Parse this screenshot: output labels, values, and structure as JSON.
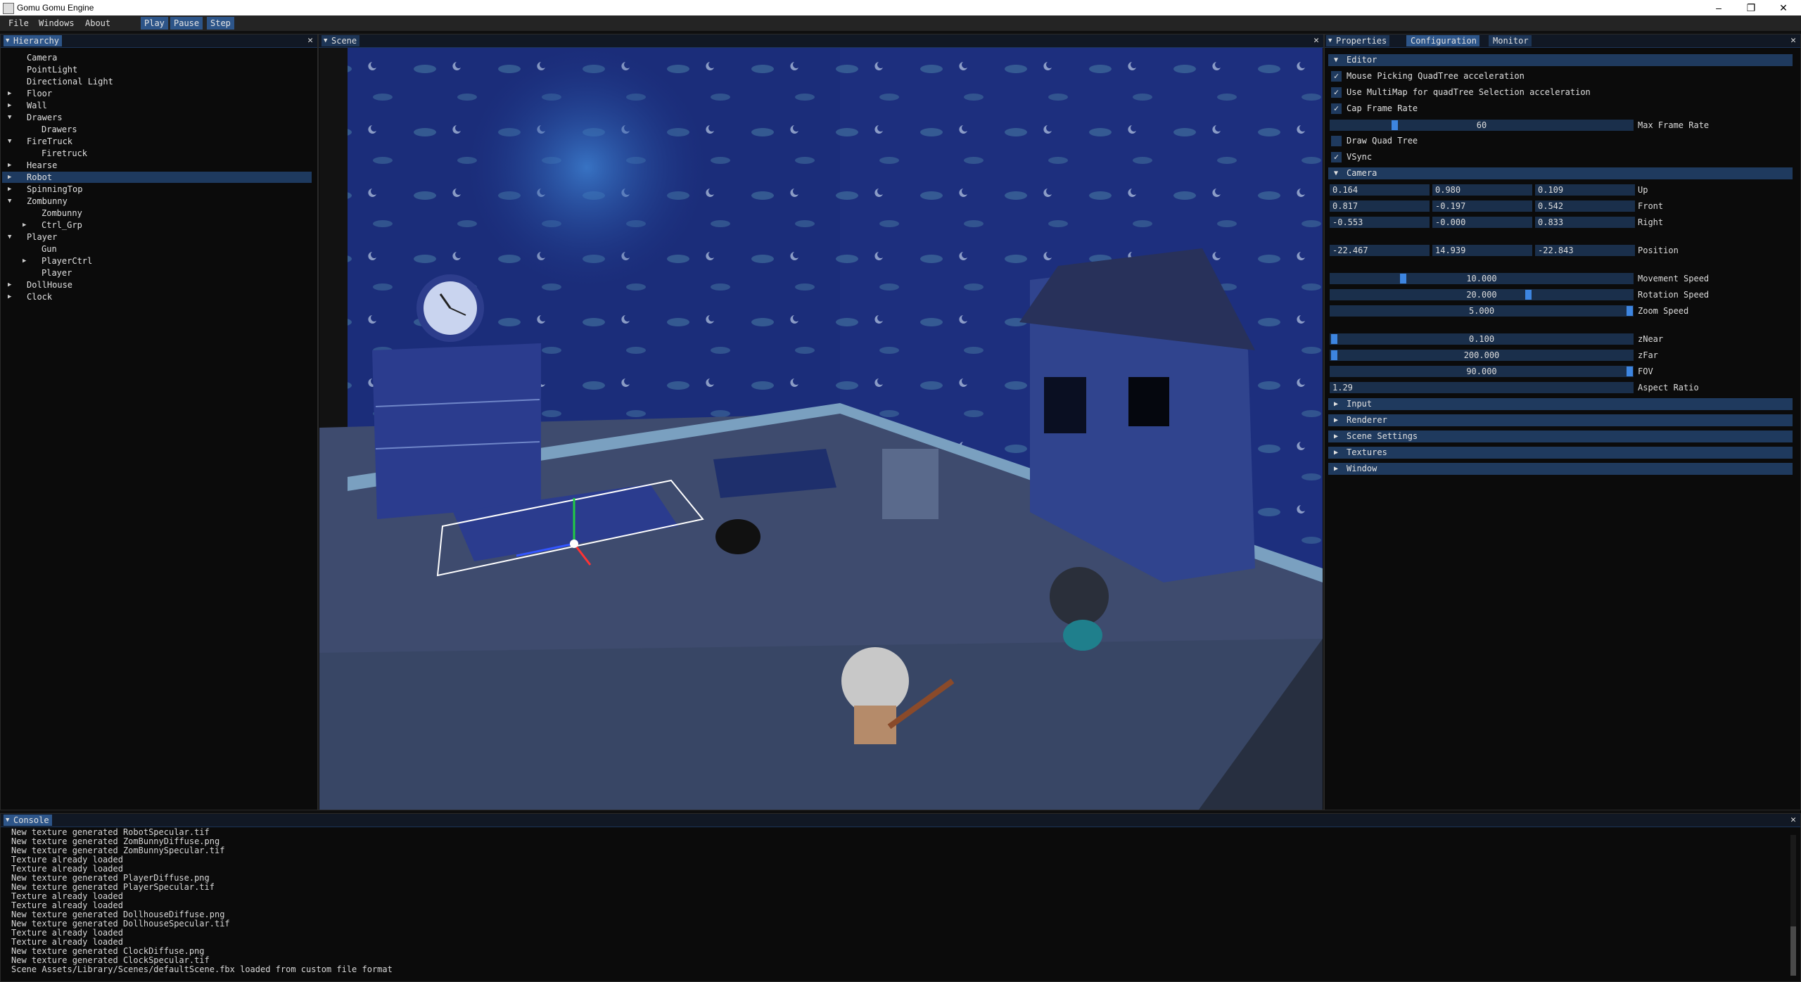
{
  "window": {
    "title": "Gomu Gomu Engine"
  },
  "menubar": {
    "file": "File",
    "windows": "Windows",
    "about": "About",
    "play": "Play",
    "pause": "Pause",
    "step": "Step"
  },
  "hierarchy": {
    "title": "Hierarchy",
    "items": [
      {
        "label": "Camera",
        "depth": 1,
        "arrow": ""
      },
      {
        "label": "PointLight",
        "depth": 1,
        "arrow": ""
      },
      {
        "label": "Directional Light",
        "depth": 1,
        "arrow": ""
      },
      {
        "label": "Floor",
        "depth": 1,
        "arrow": "collapsed"
      },
      {
        "label": "Wall",
        "depth": 1,
        "arrow": "collapsed"
      },
      {
        "label": "Drawers",
        "depth": 1,
        "arrow": "expanded"
      },
      {
        "label": "Drawers",
        "depth": 2,
        "arrow": ""
      },
      {
        "label": "FireTruck",
        "depth": 1,
        "arrow": "expanded"
      },
      {
        "label": "Firetruck",
        "depth": 2,
        "arrow": ""
      },
      {
        "label": "Hearse",
        "depth": 1,
        "arrow": "collapsed"
      },
      {
        "label": "Robot",
        "depth": 1,
        "arrow": "collapsed",
        "selected": true
      },
      {
        "label": "SpinningTop",
        "depth": 1,
        "arrow": "collapsed"
      },
      {
        "label": "Zombunny",
        "depth": 1,
        "arrow": "expanded"
      },
      {
        "label": "Zombunny",
        "depth": 2,
        "arrow": ""
      },
      {
        "label": "Ctrl_Grp",
        "depth": 2,
        "arrow": "collapsed"
      },
      {
        "label": "Player",
        "depth": 1,
        "arrow": "expanded"
      },
      {
        "label": "Gun",
        "depth": 2,
        "arrow": ""
      },
      {
        "label": "PlayerCtrl",
        "depth": 2,
        "arrow": "collapsed"
      },
      {
        "label": "Player",
        "depth": 2,
        "arrow": ""
      },
      {
        "label": "DollHouse",
        "depth": 1,
        "arrow": "collapsed"
      },
      {
        "label": "Clock",
        "depth": 1,
        "arrow": "collapsed"
      }
    ]
  },
  "scene": {
    "title": "Scene"
  },
  "properties": {
    "tabs": [
      "Properties",
      "Configuration",
      "Monitor"
    ],
    "active_tab": 1,
    "editor": {
      "header": "Editor",
      "mouse_picking": "Mouse Picking QuadTree acceleration",
      "use_multimap": "Use MultiMap for quadTree Selection acceleration",
      "cap_frame_rate": "Cap Frame Rate",
      "max_frame_rate_value": "60",
      "max_frame_rate_fraction": 0.23,
      "max_frame_rate_label": "Max Frame Rate",
      "draw_quad_tree": "Draw Quad Tree",
      "vsync": "VSync",
      "checked": {
        "mouse_picking": true,
        "use_multimap": true,
        "cap_frame_rate": true,
        "draw_quad_tree": false,
        "vsync": true
      }
    },
    "camera": {
      "header": "Camera",
      "up": [
        "0.164",
        "0.980",
        "0.109"
      ],
      "up_label": "Up",
      "front": [
        "0.817",
        "-0.197",
        "0.542"
      ],
      "front_label": "Front",
      "right": [
        "-0.553",
        "-0.000",
        "0.833"
      ],
      "right_label": "Right",
      "position": [
        "-22.467",
        "14.939",
        "-22.843"
      ],
      "position_label": "Position",
      "movement_speed": "10.000",
      "movement_speed_label": "Movement Speed",
      "movement_fraction": 0.24,
      "rotation_speed": "20.000",
      "rotation_speed_label": "Rotation Speed",
      "rotation_fraction": 0.65,
      "zoom_speed": "5.000",
      "zoom_speed_label": "Zoom Speed",
      "zoom_fraction": 1.0,
      "znear": "0.100",
      "znear_label": "zNear",
      "znear_fraction": 0.0,
      "zfar": "200.000",
      "zfar_label": "zFar",
      "zfar_fraction": 0.0,
      "fov": "90.000",
      "fov_label": "FOV",
      "fov_fraction": 1.0,
      "aspect_ratio": "1.29",
      "aspect_ratio_label": "Aspect Ratio"
    },
    "sections": [
      "Input",
      "Renderer",
      "Scene Settings",
      "Textures",
      "Window"
    ]
  },
  "console": {
    "title": "Console",
    "lines": [
      "New texture generated RobotSpecular.tif",
      "New texture generated ZomBunnyDiffuse.png",
      "New texture generated ZomBunnySpecular.tif",
      "Texture already loaded",
      "Texture already loaded",
      "New texture generated PlayerDiffuse.png",
      "New texture generated PlayerSpecular.tif",
      "Texture already loaded",
      "Texture already loaded",
      "New texture generated DollhouseDiffuse.png",
      "New texture generated DollhouseSpecular.tif",
      "Texture already loaded",
      "Texture already loaded",
      "New texture generated ClockDiffuse.png",
      "New texture generated ClockSpecular.tif",
      "Scene Assets/Library/Scenes/defaultScene.fbx loaded from custom file format"
    ]
  },
  "colors": {
    "accent": "#2d5589",
    "header_bg": "#1f3a5e",
    "field_bg": "#1a2f4b",
    "slider_grab": "#3d85e0"
  }
}
